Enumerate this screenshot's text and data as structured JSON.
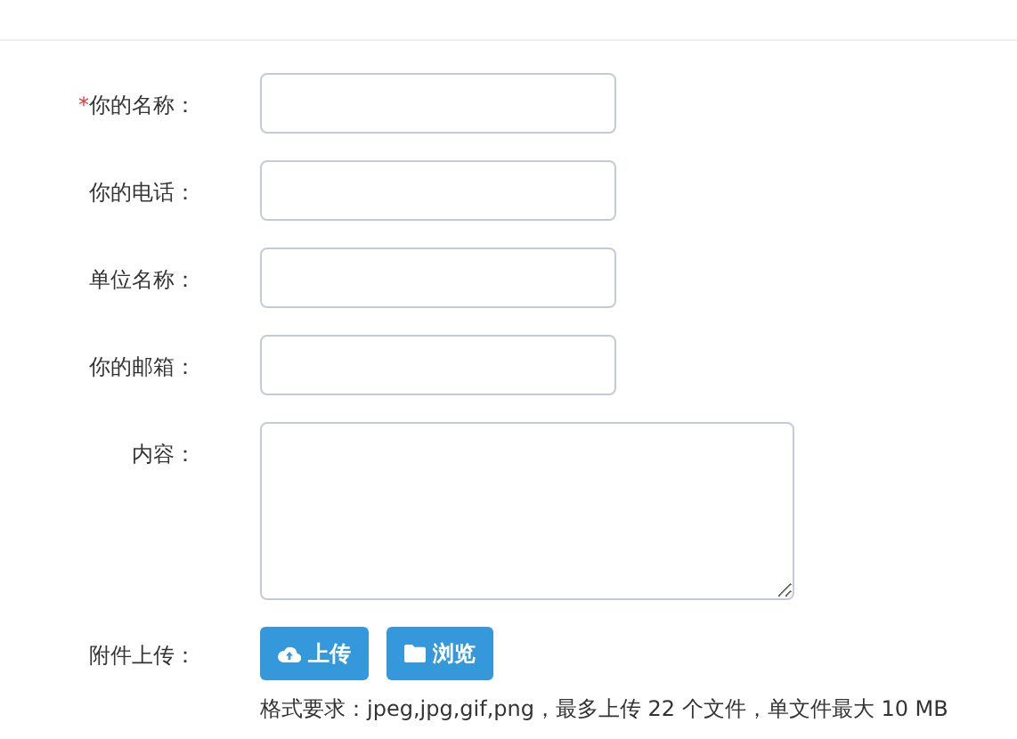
{
  "fields": [
    {
      "label": "你的名称：",
      "marker": "*",
      "kind": "input"
    },
    {
      "label": "你的电话：",
      "kind": "input"
    },
    {
      "label": "单位名称：",
      "kind": "input"
    },
    {
      "label": "你的邮箱：",
      "kind": "input"
    },
    {
      "label": "内容：",
      "kind": "textarea"
    }
  ],
  "attachment": {
    "label": "附件上传：",
    "buttons": [
      {
        "label": "上传",
        "kind": "upload"
      },
      {
        "label": "浏览",
        "kind": "browse"
      }
    ],
    "hint": "格式要求：jpeg,jpg,gif,png，最多上传 22 个文件，单文件最大 10 MB"
  }
}
